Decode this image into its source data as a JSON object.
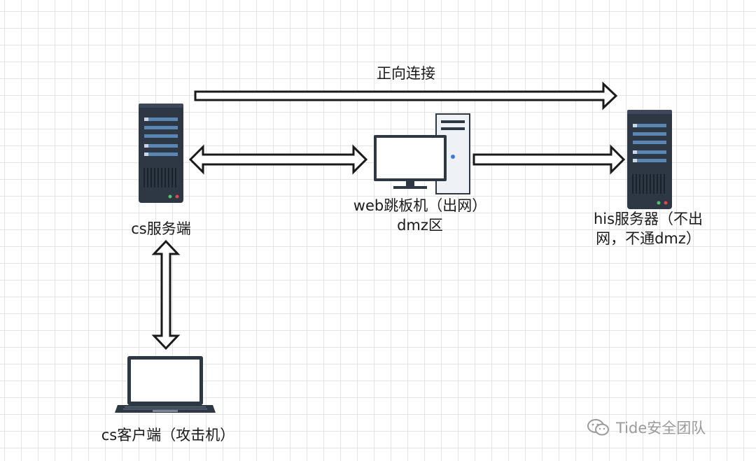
{
  "diagram": {
    "top_label": "正向连接",
    "nodes": {
      "cs_server": {
        "label": "cs服务端"
      },
      "web_jump": {
        "line1": "web跳板机（出网）",
        "line2": "dmz区"
      },
      "his_server": {
        "line1": "his服务器（不出",
        "line2": "网，不通dmz）"
      },
      "cs_client": {
        "label": "cs客户端（攻击机）"
      }
    }
  },
  "watermark": {
    "text": "Tide安全团队",
    "icon": "wechat-icon"
  },
  "colors": {
    "server_body": "#2e3744",
    "server_slot": "#5b86b4",
    "arrow_stroke": "#1a1a1a",
    "screen_bezel": "#2e3744"
  }
}
